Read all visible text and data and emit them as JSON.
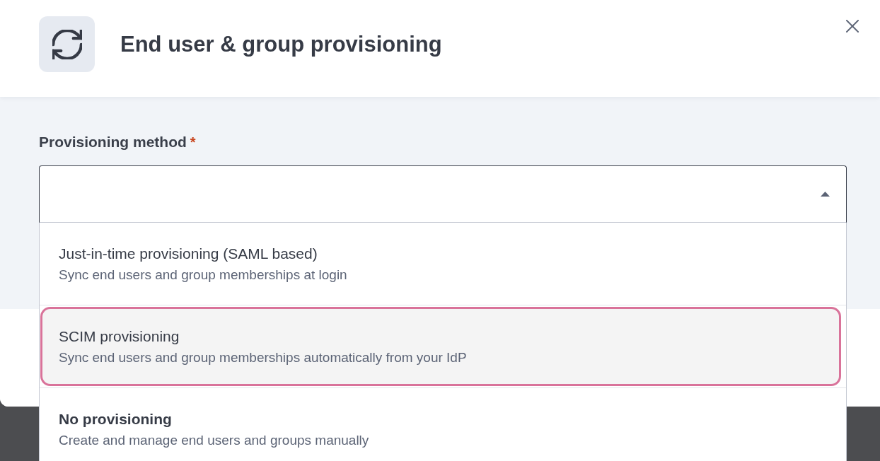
{
  "dialog": {
    "title": "End user & group provisioning"
  },
  "provisioning_method": {
    "label": "Provisioning method",
    "required_mark": "*",
    "expanded": true,
    "options": [
      {
        "title": "Just-in-time provisioning (SAML based)",
        "description": "Sync end users and group memberships at login",
        "selected": false,
        "focused": false
      },
      {
        "title": "SCIM provisioning",
        "description": "Sync end users and group memberships automatically from your IdP",
        "selected": false,
        "focused": true
      },
      {
        "title": "No provisioning",
        "description": "Create and manage end users and groups manually",
        "selected": true,
        "focused": false
      }
    ]
  }
}
